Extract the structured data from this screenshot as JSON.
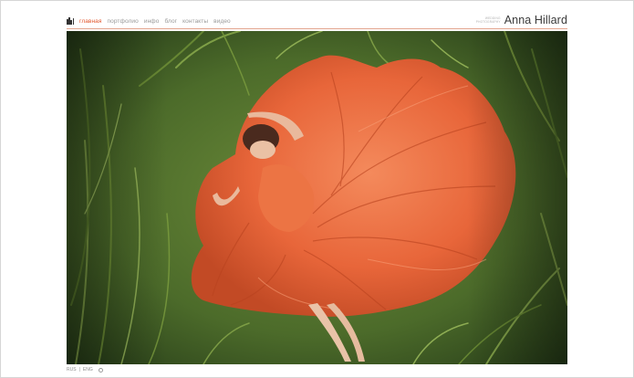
{
  "nav": {
    "items": [
      {
        "label": "главная",
        "active": true
      },
      {
        "label": "портфолио",
        "active": false
      },
      {
        "label": "инфо",
        "active": false
      },
      {
        "label": "блог",
        "active": false
      },
      {
        "label": "контакты",
        "active": false
      },
      {
        "label": "видео",
        "active": false
      }
    ],
    "accent_color": "#e2582f"
  },
  "brand": {
    "sub_line_1": "WEDDING",
    "sub_line_2": "PHOTOGRAPHY",
    "name": "Anna Hillard"
  },
  "photo": {
    "description_icon": "woman-in-orange-dress-on-grass"
  },
  "footer": {
    "lang_active": "RUS",
    "separator": "|",
    "lang_other": "ENG",
    "icon": "info-icon"
  }
}
